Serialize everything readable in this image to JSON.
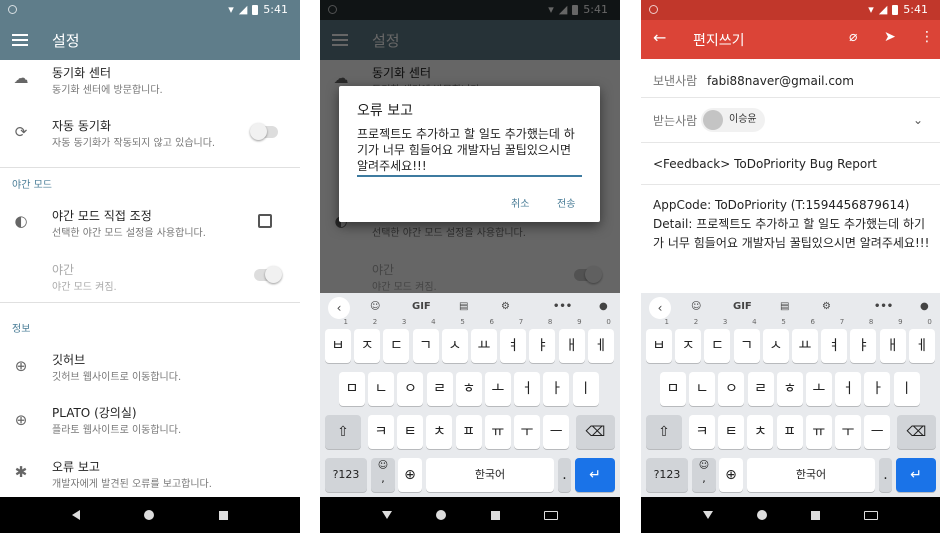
{
  "status": {
    "time": "5:41"
  },
  "settings": {
    "title": "설정",
    "items": [
      {
        "title": "동기화 센터",
        "sub": "동기화 센터에 방문합니다."
      },
      {
        "title": "자동 동기화",
        "sub": "자동 동기화가 작동되지 않고 있습니다."
      },
      {
        "title": "야간 모드 직접 조정",
        "sub": "선택한 야간 모드 설정을 사용합니다."
      },
      {
        "title": "야간",
        "sub": "야간 모드 켜짐."
      },
      {
        "title": "깃허브",
        "sub": "깃허브 웹사이트로 이동합니다."
      },
      {
        "title": "PLATO (강의실)",
        "sub": "플라토 웹사이트로 이동합니다."
      },
      {
        "title": "오류 보고",
        "sub": "개발자에게 발견된 오류를 보고합니다."
      }
    ],
    "sections": {
      "night": "야간 모드",
      "info": "정보"
    }
  },
  "dialog": {
    "title": "오류 보고",
    "message": "프로젝트도 추가하고 할 일도 추가했는데 하기가 너무 힘들어요 개발자님 꿀팁있으시면 알려주세요!!!",
    "cancel": "취소",
    "send": "전송"
  },
  "keyboard": {
    "gif": "GIF",
    "row1": [
      "ㅂ",
      "ㅈ",
      "ㄷ",
      "ㄱ",
      "ㅅ",
      "ㅛ",
      "ㅕ",
      "ㅑ",
      "ㅐ",
      "ㅔ"
    ],
    "row1_hints": [
      "1",
      "2",
      "3",
      "4",
      "5",
      "6",
      "7",
      "8",
      "9",
      "0"
    ],
    "row2": [
      "ㅁ",
      "ㄴ",
      "ㅇ",
      "ㄹ",
      "ㅎ",
      "ㅗ",
      "ㅓ",
      "ㅏ",
      "ㅣ"
    ],
    "row3": [
      "ㅋ",
      "ㅌ",
      "ㅊ",
      "ㅍ",
      "ㅠ",
      "ㅜ",
      "ㅡ"
    ],
    "sym": "?123",
    "space": "한국어",
    "period": ".",
    "emoji_label": "☺",
    "comma": ","
  },
  "compose": {
    "title": "편지쓰기",
    "from_label": "보낸사람",
    "from": "fabi88naver@gmail.com",
    "to_label": "받는사람",
    "to": "이승윤",
    "subject": "<Feedback> ToDoPriority Bug Report",
    "body": "AppCode: ToDoPriority (T:1594456879614)\nDetail: 프로젝트도 추가하고 할 일도 추가했는데 하기가 너무 힘들어요 개발자님 꿀팁있으시면 알려주세요!!!"
  },
  "colors": {
    "settings_bar": "#5f7d8a",
    "gmail_bar": "#db4437",
    "accent": "#1a73e8"
  }
}
